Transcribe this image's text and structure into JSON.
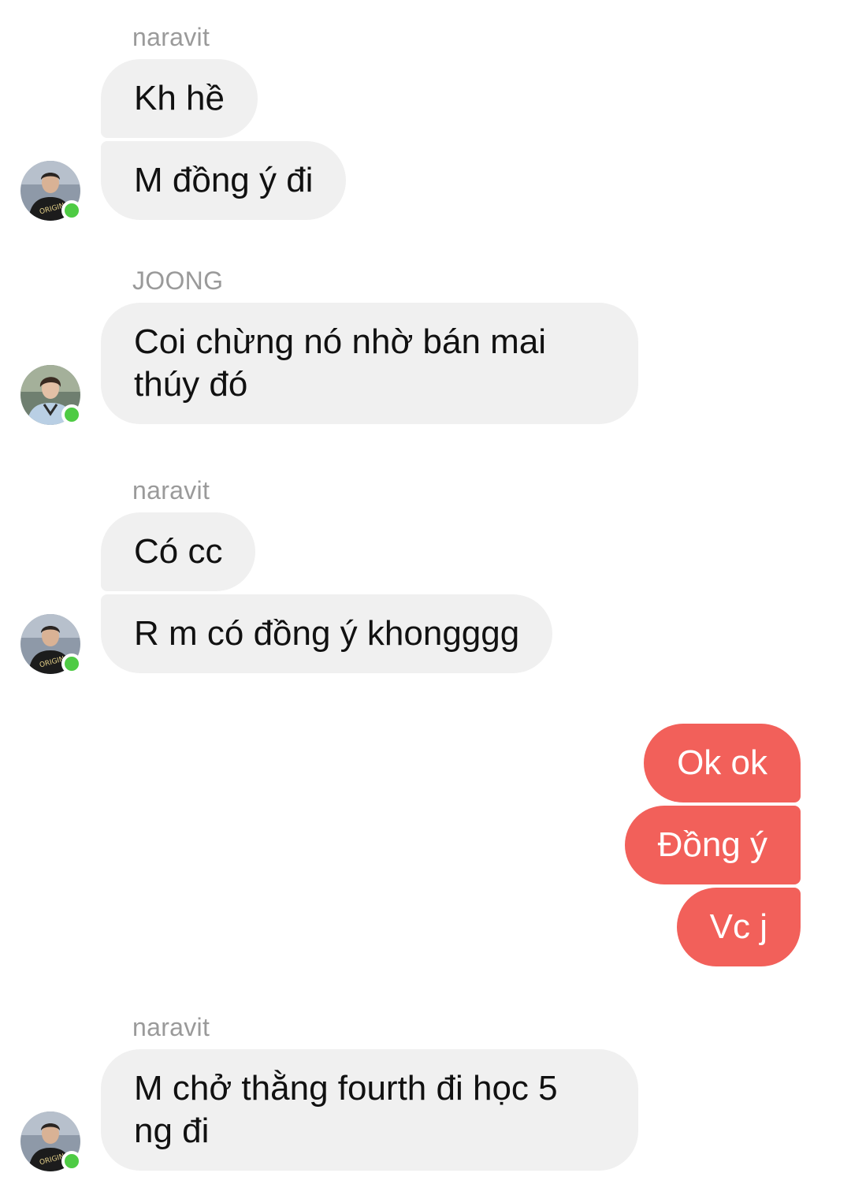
{
  "groups": [
    {
      "sender": "naravit",
      "messages": [
        "Kh hề",
        "M đồng ý đi"
      ],
      "avatar_icon": "profile-photo-naravit"
    },
    {
      "sender": "JOONG",
      "messages": [
        "Coi chừng nó nhờ bán mai thúy đó"
      ],
      "avatar_icon": "profile-photo-joong"
    },
    {
      "sender": "naravit",
      "messages": [
        "Có cc",
        "R m có đồng ý khongggg"
      ],
      "avatar_icon": "profile-photo-naravit"
    },
    {
      "sender": "me",
      "messages": [
        "Ok ok",
        "Đồng ý",
        "Vc j"
      ]
    },
    {
      "sender": "naravit",
      "messages": [
        "M chở thằng fourth đi học 5 ng đi"
      ],
      "avatar_icon": "profile-photo-naravit"
    }
  ],
  "colors": {
    "incoming_bubble": "#f0f0f0",
    "outgoing_bubble": "#f2605a",
    "online_dot": "#4ecb44",
    "sender_name": "#9a9a9a"
  }
}
